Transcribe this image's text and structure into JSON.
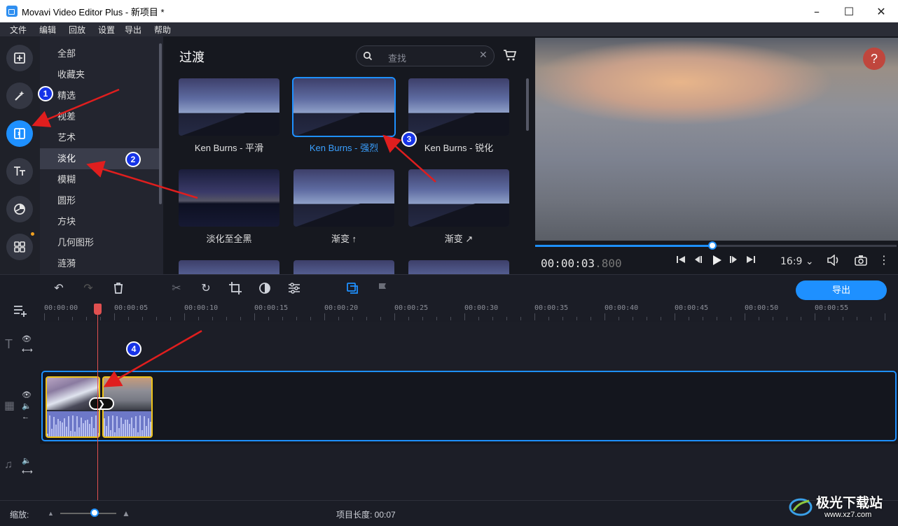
{
  "window": {
    "title": "Movavi Video Editor Plus - 新项目 *",
    "controls": [
      "–",
      "☐",
      "✕"
    ]
  },
  "menu": [
    "文件",
    "编辑",
    "回放",
    "设置",
    "导出",
    "帮助"
  ],
  "rail": {
    "items": [
      {
        "icon": "import-icon"
      },
      {
        "icon": "magic-wand-icon"
      },
      {
        "icon": "transitions-icon",
        "active": true
      },
      {
        "icon": "titles-icon"
      },
      {
        "icon": "filters-icon"
      },
      {
        "icon": "more-tools-icon"
      }
    ]
  },
  "categories": [
    "全部",
    "收藏夹",
    "精选",
    "视差",
    "艺术",
    "淡化",
    "模糊",
    "圆形",
    "方块",
    "几何图形",
    "涟漪"
  ],
  "active_category": "淡化",
  "panel": {
    "title": "过渡",
    "search_placeholder": "查找",
    "transitions": [
      {
        "label": "Ken Burns - 平滑",
        "selected": false
      },
      {
        "label": "Ken Burns - 强烈",
        "selected": true
      },
      {
        "label": "Ken Burns - 锐化",
        "selected": false
      },
      {
        "label": "淡化至全黑",
        "selected": false
      },
      {
        "label": "渐变 ↑",
        "selected": false
      },
      {
        "label": "渐变 ↗",
        "selected": false
      }
    ]
  },
  "preview": {
    "help": "?",
    "time_main": "00:00:03",
    "time_ms": ".800",
    "progress": 0.49,
    "aspect": "16:9",
    "aspect_arrow": "⌄"
  },
  "toolbar": {
    "export_label": "导出"
  },
  "ruler": [
    "00:00:00",
    "00:00:05",
    "00:00:10",
    "00:00:15",
    "00:00:20",
    "00:00:25",
    "00:00:30",
    "00:00:35",
    "00:00:40",
    "00:00:45",
    "00:00:50",
    "00:00:55"
  ],
  "bottom": {
    "zoom_label": "缩放:",
    "project_length": "项目长度: 00:07"
  },
  "annotations": [
    "1",
    "2",
    "3",
    "4"
  ],
  "watermark": {
    "brand": "极光下载站",
    "url": "www.xz7.com"
  },
  "colors": {
    "accent": "#1e90ff",
    "clip_border": "#f0c419",
    "annotation_arrow": "#e01e1e",
    "playhead": "#e05050"
  }
}
